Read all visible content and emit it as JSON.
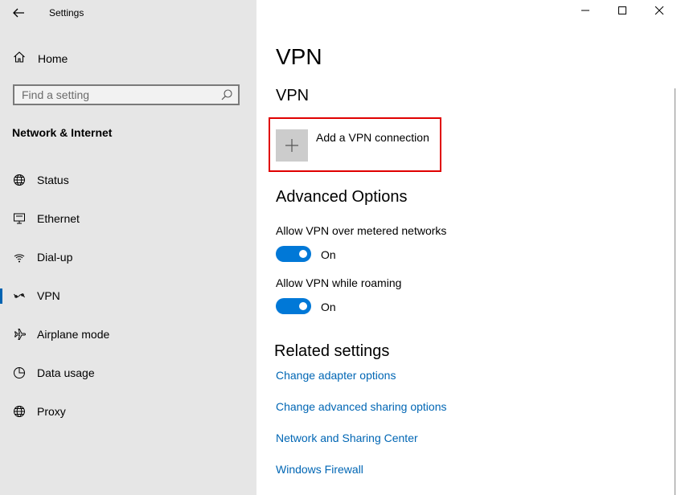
{
  "window": {
    "title": "Settings",
    "controls": {
      "minimize": "minimize-icon",
      "maximize": "maximize-icon",
      "close": "close-icon"
    }
  },
  "sidebar": {
    "home_label": "Home",
    "search": {
      "placeholder": "Find a setting",
      "value": ""
    },
    "section_header": "Network & Internet",
    "items": [
      {
        "label": "Status",
        "icon": "globe-status-icon",
        "active": false
      },
      {
        "label": "Ethernet",
        "icon": "ethernet-icon",
        "active": false
      },
      {
        "label": "Dial-up",
        "icon": "dialup-icon",
        "active": false
      },
      {
        "label": "VPN",
        "icon": "vpn-icon",
        "active": true
      },
      {
        "label": "Airplane mode",
        "icon": "airplane-icon",
        "active": false
      },
      {
        "label": "Data usage",
        "icon": "data-usage-icon",
        "active": false
      },
      {
        "label": "Proxy",
        "icon": "globe-icon",
        "active": false
      }
    ],
    "accent_color": "#0063b1"
  },
  "main": {
    "page_title": "VPN",
    "vpn_section_title": "VPN",
    "add_vpn_label": "Add a VPN connection",
    "advanced_title": "Advanced Options",
    "toggles": [
      {
        "label": "Allow VPN over metered networks",
        "state": "On",
        "on": true
      },
      {
        "label": "Allow VPN while roaming",
        "state": "On",
        "on": true
      }
    ],
    "related_title": "Related settings",
    "links": [
      "Change adapter options",
      "Change advanced sharing options",
      "Network and Sharing Center",
      "Windows Firewall"
    ],
    "link_color": "#0066b4",
    "toggle_color": "#0078d7",
    "highlight_color": "#e00000"
  }
}
